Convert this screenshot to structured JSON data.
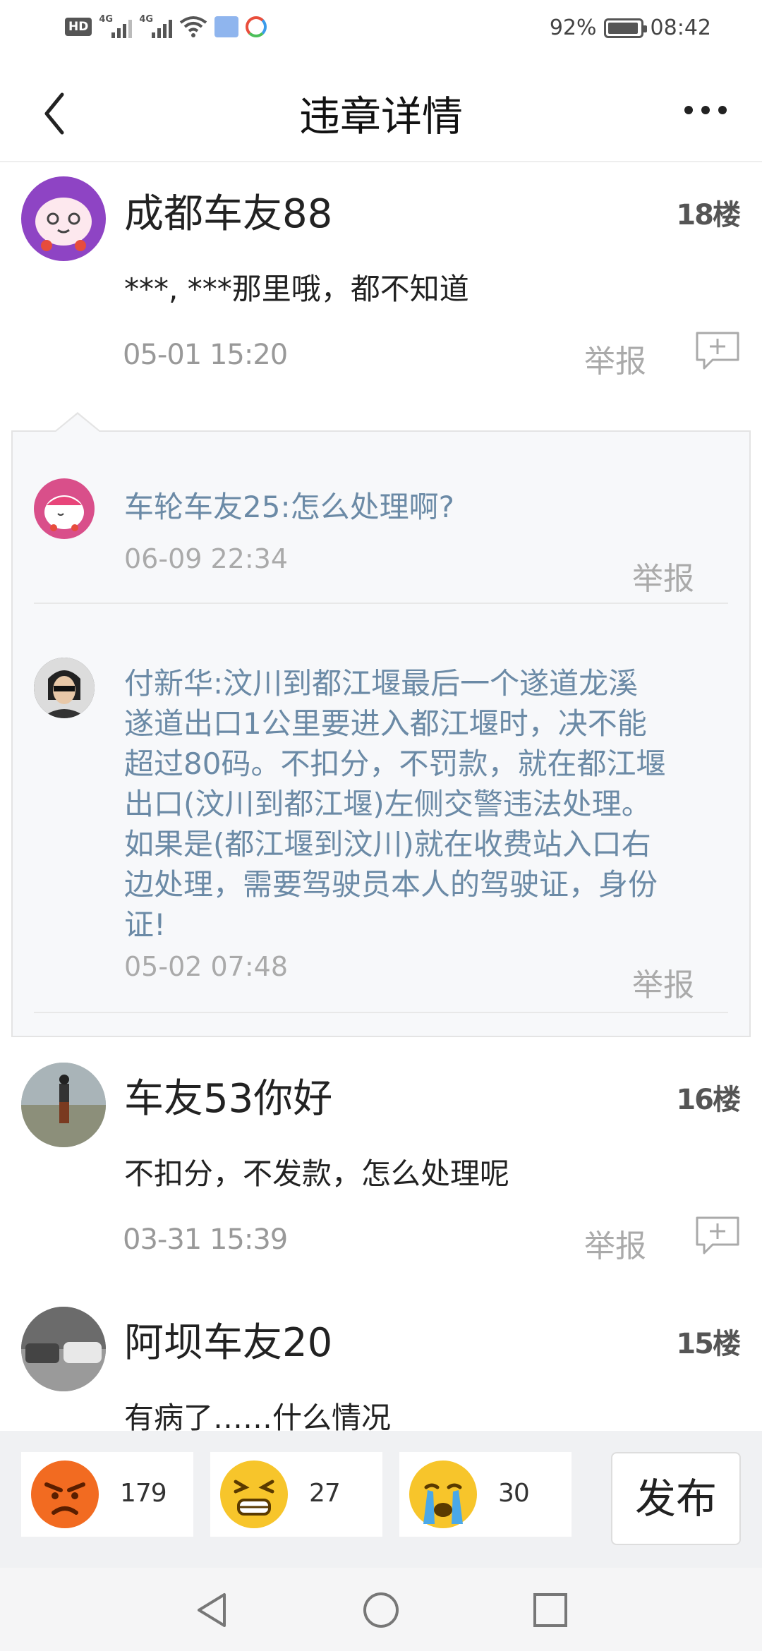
{
  "status_bar": {
    "hd": "HD",
    "signal1_label": "4G",
    "signal2_label": "4G",
    "battery_percent": "92%",
    "time": "08:42"
  },
  "header": {
    "title": "违章详情"
  },
  "posts": [
    {
      "username": "成都车友88",
      "floor": "18楼",
      "content": "***, ***那里哦，都不知道",
      "time": "05-01  15:20",
      "report": "举报"
    },
    {
      "username": "车友53你好",
      "floor": "16楼",
      "content": "不扣分，不发款，怎么处理呢",
      "time": "03-31  15:39",
      "report": "举报"
    },
    {
      "username": "阿坝车友20",
      "floor": "15楼",
      "content": "有病了……什么情况"
    }
  ],
  "replies": [
    {
      "text": "车轮车友25:怎么处理啊?",
      "time": "06-09  22:34",
      "report": "举报"
    },
    {
      "text_lines": [
        "付新华:汶川到都江堰最后一个遂道龙溪",
        "遂道出口1公里要进入都江堰时，决不能",
        "超过80码。不扣分，不罚款，就在都江堰",
        "出口(汶川到都江堰)左侧交警违法处理。",
        "如果是(都江堰到汶川)就在收费站入口右",
        "边处理，需要驾驶员本人的驾驶证，身份",
        "证!"
      ],
      "time": "05-02  07:48",
      "report": "举报"
    }
  ],
  "reactions": [
    {
      "icon": "angry-face-icon",
      "count": "179"
    },
    {
      "icon": "grimace-face-icon",
      "count": "27"
    },
    {
      "icon": "crying-face-icon",
      "count": "30"
    }
  ],
  "publish_label": "发布",
  "colors": {
    "reply_text": "#6b8aa6",
    "accent_avatar_purple": "#8e44c4"
  }
}
